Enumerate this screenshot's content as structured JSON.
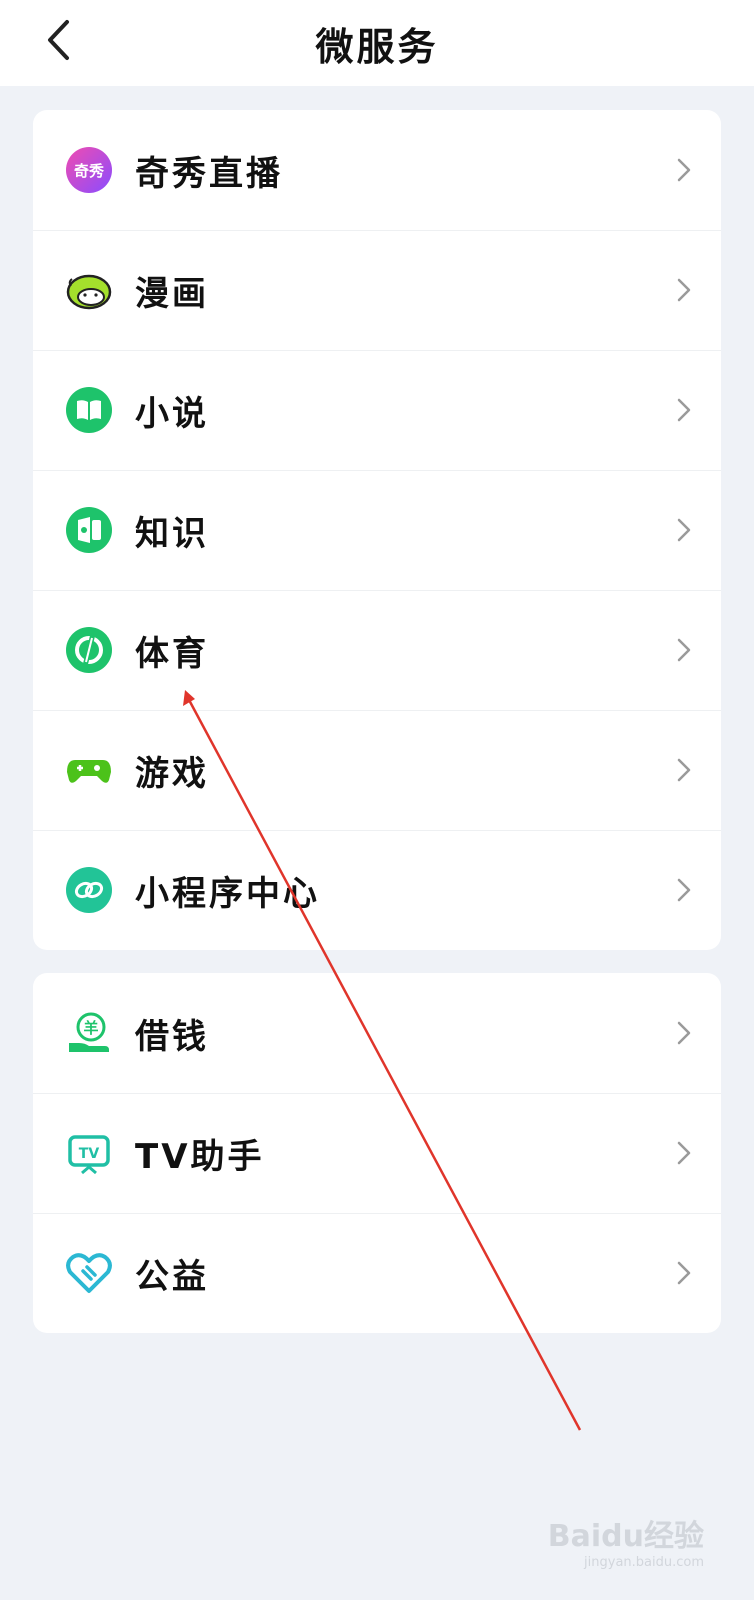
{
  "header": {
    "title": "微服务",
    "back_icon": "chevron-left-icon"
  },
  "groups": [
    {
      "items": [
        {
          "label": "奇秀直播",
          "icon": "qixiu-live-icon",
          "icon_text": "奇秀"
        },
        {
          "label": "漫画",
          "icon": "comic-icon"
        },
        {
          "label": "小说",
          "icon": "book-icon"
        },
        {
          "label": "知识",
          "icon": "knowledge-icon"
        },
        {
          "label": "体育",
          "icon": "sports-icon"
        },
        {
          "label": "游戏",
          "icon": "gamepad-icon"
        },
        {
          "label": "小程序中心",
          "icon": "mini-program-icon"
        }
      ]
    },
    {
      "items": [
        {
          "label": "借钱",
          "icon": "loan-icon",
          "icon_text": "羊"
        },
        {
          "label": "TV助手",
          "icon": "tv-icon",
          "icon_text": "TV"
        },
        {
          "label": "公益",
          "icon": "heart-icon"
        }
      ]
    }
  ],
  "watermark": {
    "text": "Baidu经验",
    "sub": "jingyan.baidu.com"
  },
  "colors": {
    "accent": "#1ec36b",
    "annotation": "#e0352b",
    "background": "#eff2f7"
  }
}
